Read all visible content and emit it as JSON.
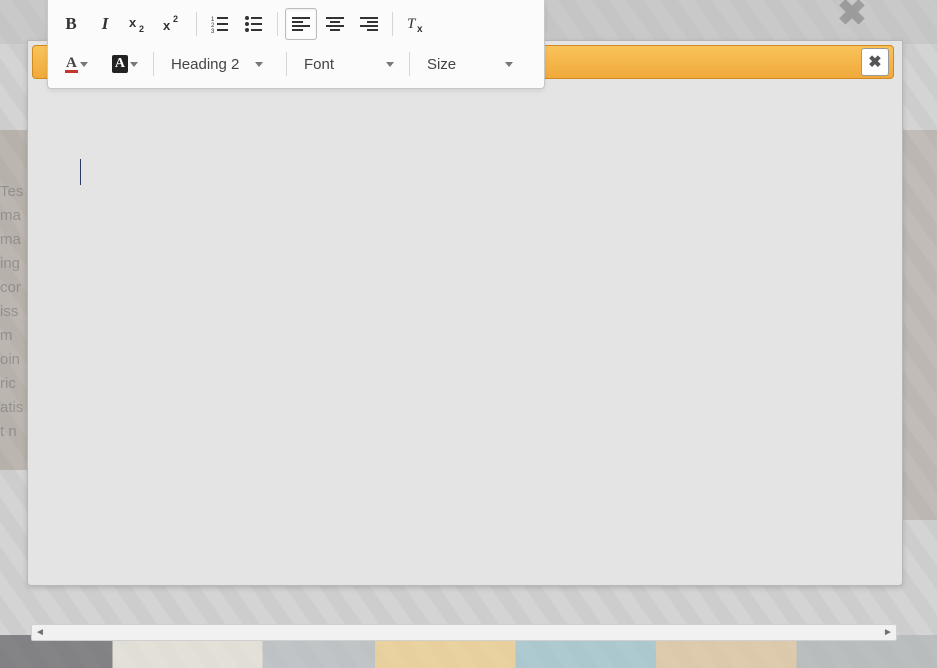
{
  "background": {
    "lines": "Tes\nma\nma\ning\ncor\niss\nm\noin\nric\natis\nt n",
    "close_glyph": "✖"
  },
  "modal": {
    "close_icon": "✖"
  },
  "toolbar": {
    "bold_label": "B",
    "italic_label": "I",
    "textcolor_letter": "A",
    "bgcolor_letter": "A",
    "format_label": "Heading 2",
    "font_label": "Font",
    "size_label": "Size"
  },
  "editor": {
    "content": ""
  }
}
